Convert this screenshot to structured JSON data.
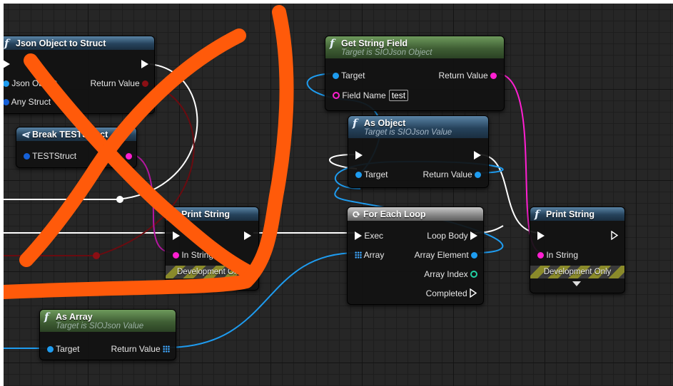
{
  "colors": {
    "exec": "#ffffff",
    "object_pin": "#1e9cf0",
    "string_pin": "#ff1fd1",
    "struct_pin": "#1560d8",
    "annotation": "#ff5a0a"
  },
  "nodes": {
    "json_to_struct": {
      "title": "Json Object to Struct",
      "in_exec": "",
      "pin_json_object": "Json Object",
      "pin_any_struct": "Any Struct",
      "pin_return": "Return Value"
    },
    "break_struct": {
      "title": "Break TESTStruct",
      "pin_member": "TESTStruct"
    },
    "get_string_field": {
      "title": "Get String Field",
      "subtitle": "Target is SIOJson Object",
      "pin_target": "Target",
      "pin_field_name": "Field Name",
      "field_name_value": "test",
      "pin_return": "Return Value"
    },
    "as_object": {
      "title": "As Object",
      "subtitle": "Target is SIOJson Value",
      "pin_target": "Target",
      "pin_return": "Return Value"
    },
    "print_string_left": {
      "title": "Print String",
      "pin_in_string": "In String",
      "dev_label": "Development Only"
    },
    "for_each_loop": {
      "title": "For Each Loop",
      "pin_exec": "Exec",
      "pin_array": "Array",
      "pin_loop_body": "Loop Body",
      "pin_array_element": "Array Element",
      "pin_array_index": "Array Index",
      "pin_completed": "Completed"
    },
    "print_string_right": {
      "title": "Print String",
      "pin_in_string": "In String",
      "dev_label": "Development Only"
    },
    "as_array": {
      "title": "As Array",
      "subtitle": "Target is SIOJson Value",
      "pin_target": "Target",
      "pin_return": "Return Value"
    }
  }
}
